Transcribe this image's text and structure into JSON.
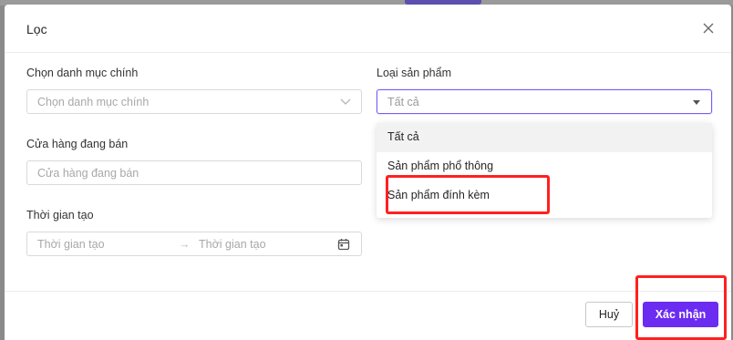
{
  "dialog": {
    "title": "Lọc",
    "close_icon": "close-icon"
  },
  "fields": {
    "main_category": {
      "label": "Chọn danh mục chính",
      "placeholder": "Chọn danh mục chính",
      "icon": "chevron-down-icon"
    },
    "store": {
      "label": "Cửa hàng đang bán",
      "placeholder": "Cửa hàng đang bán"
    },
    "created_time": {
      "label": "Thời gian tạo",
      "start_placeholder": "Thời gian tạo",
      "separator": "→",
      "end_placeholder": "Thời gian tạo",
      "icon": "calendar-icon"
    },
    "product_type": {
      "label": "Loại sản phẩm",
      "value": "Tất cả",
      "icon": "caret-down-icon",
      "options": [
        "Tất cả",
        "Sản phẩm phổ thông",
        "Sản phẩm đính kèm"
      ],
      "selected": "Tất cả"
    }
  },
  "footer": {
    "cancel_label": "Huỷ",
    "confirm_label": "Xác nhận"
  },
  "colors": {
    "accent": "#6c2bf0",
    "annotation": "#ff2020"
  }
}
